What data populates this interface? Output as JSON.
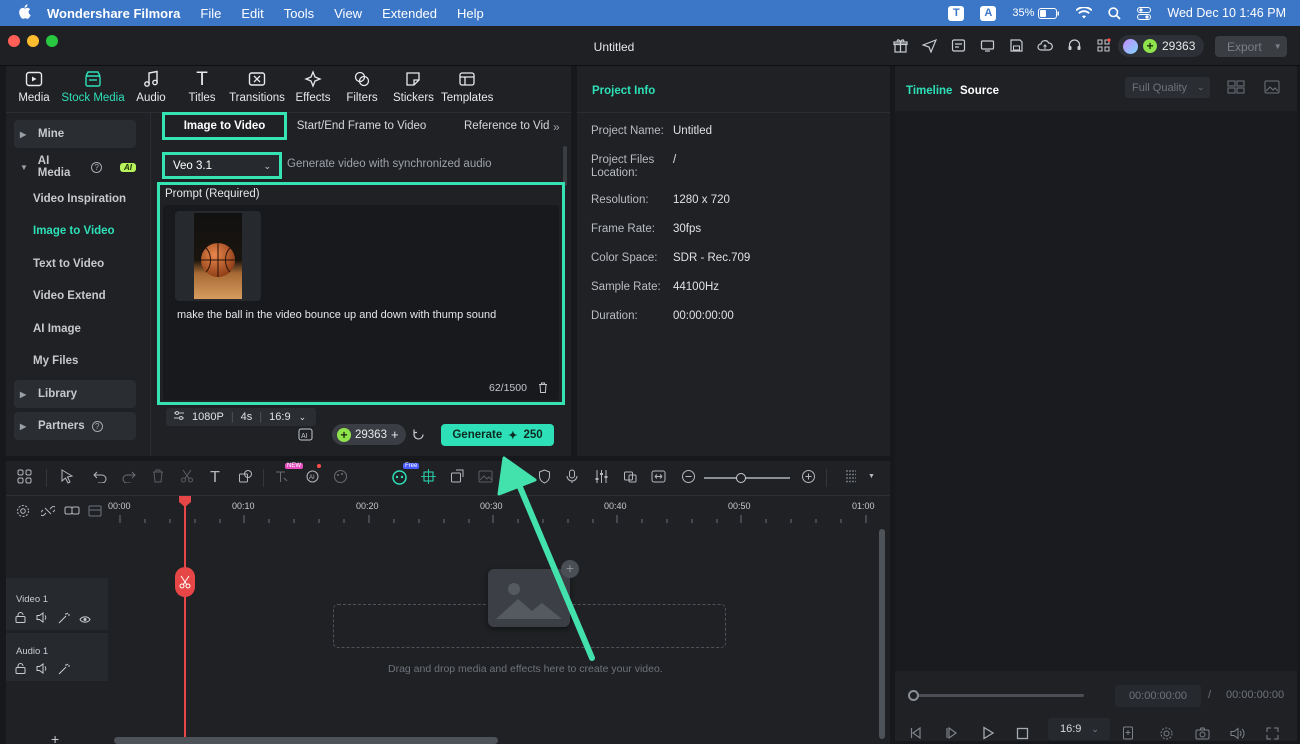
{
  "menubar": {
    "app_name": "Wondershare Filmora",
    "items": [
      "File",
      "Edit",
      "Tools",
      "View",
      "Extended",
      "Help"
    ],
    "battery": "35%",
    "datetime": "Wed Dec 10  1:46 PM",
    "box_t": "T",
    "box_a": "A"
  },
  "window": {
    "title": "Untitled",
    "credits": "29363",
    "export_label": "Export"
  },
  "tool_tabs": [
    "Media",
    "Stock Media",
    "Audio",
    "Titles",
    "Transitions",
    "Effects",
    "Filters",
    "Stickers",
    "Templates"
  ],
  "sidebar": {
    "mine": "Mine",
    "ai_media": "AI Media",
    "ai_badge": "AI",
    "sub_items": [
      "Video Inspiration",
      "Image to Video",
      "Text to Video",
      "Video Extend",
      "AI Image",
      "My Files"
    ],
    "library": "Library",
    "partners": "Partners"
  },
  "generator": {
    "tabs": [
      "Image to Video",
      "Start/End Frame to Video",
      "Reference to Vid"
    ],
    "model": "Veo 3.1",
    "model_desc": "Generate video with synchronized audio",
    "prompt_label": "Prompt (Required)",
    "prompt_text": "make the ball in the video bounce up and down with thump sound",
    "char_count": "62/1500",
    "settings": {
      "resolution": "1080P",
      "duration": "4s",
      "aspect": "16:9"
    },
    "credits": "29363",
    "generate_label": "Generate",
    "generate_cost": "250"
  },
  "project_info": {
    "title": "Project Info",
    "rows": [
      {
        "label": "Project Name:",
        "value": "Untitled"
      },
      {
        "label": "Project Files Location:",
        "value": "/"
      },
      {
        "label": "Resolution:",
        "value": "1280 x 720"
      },
      {
        "label": "Frame Rate:",
        "value": "30fps"
      },
      {
        "label": "Color Space:",
        "value": "SDR - Rec.709"
      },
      {
        "label": "Sample Rate:",
        "value": "44100Hz"
      },
      {
        "label": "Duration:",
        "value": "00:00:00:00"
      }
    ]
  },
  "preview": {
    "tab_timeline": "Timeline",
    "tab_source": "Source",
    "quality": "Full Quality",
    "current_time": "00:00:00:00",
    "separator": "/",
    "total_time": "00:00:00:00",
    "aspect": "16:9"
  },
  "timeline": {
    "ruler": [
      "00:00",
      "00:10",
      "00:20",
      "00:30",
      "00:40",
      "00:50",
      "01:00"
    ],
    "tracks": [
      "Video 1",
      "Audio 1"
    ],
    "drop_hint": "Drag and drop media and effects here to create your video.",
    "badge_new": "NEW",
    "badge_free": "Free"
  },
  "colors": {
    "accent": "#2ee0b7",
    "highlight": "#35e3b3",
    "playhead": "#e64646",
    "menubar": "#3b76c7"
  }
}
